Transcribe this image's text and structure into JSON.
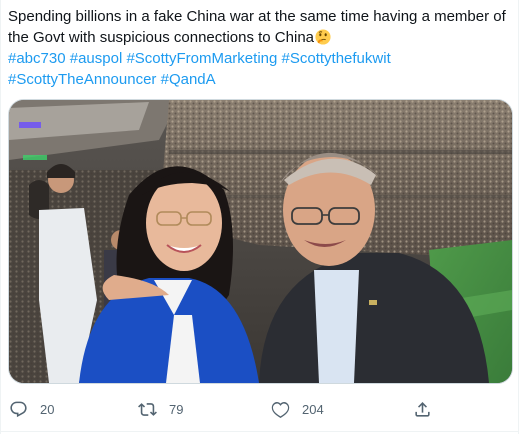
{
  "tweet": {
    "text_line1": "Spending billions in a fake China war at the same time having a member of",
    "text_line2": "the Govt with suspicious connections to China",
    "emoji": "thinking-face",
    "hashtags_line1": [
      "#abc730",
      "#auspol",
      "#ScottyFromMarketing",
      "#Scottythefukwit"
    ],
    "hashtags_line2": [
      "#ScottyTheAnnouncer",
      "#QandA"
    ]
  },
  "media": {
    "type": "photo"
  },
  "actions": {
    "reply_count": "20",
    "retweet_count": "79",
    "like_count": "204"
  },
  "colors": {
    "link": "#1d9bf0",
    "text": "#0f1419",
    "muted": "#536471"
  }
}
